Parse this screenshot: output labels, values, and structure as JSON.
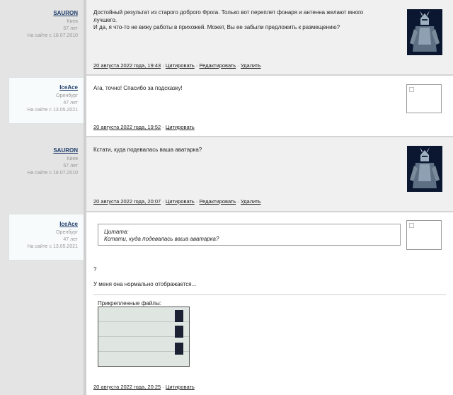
{
  "posts": [
    {
      "author": "SAURON",
      "city": "Киев",
      "age": "57 лет",
      "since": "На сайте с 18.07.2010",
      "lines": [
        "Достойный результат из старого доброго Фрога. Только вот переплет фонаря и антенна желают много",
        "лучшего.",
        "И да, я что-то не вижу работы в прихожей. Может, Вы ее забыли предложить к размещению?"
      ],
      "date": "20 августа 2022 года, 19:43",
      "quote_link": "Цитировать",
      "edit_link": "Редактировать",
      "delete_link": "Удалить"
    },
    {
      "author": "IceAce",
      "city": "Оренбург",
      "age": "47 лет",
      "since": "На сайте с 13.05.2021",
      "lines": [
        "Ага, точно! Спасибо за подсказку!"
      ],
      "date": "20 августа 2022 года, 19:52",
      "quote_link": "Цитировать"
    },
    {
      "author": "SAURON",
      "city": "Киев",
      "age": "57 лет",
      "since": "На сайте с 18.07.2010",
      "lines": [
        "Кстати, куда подевалась ваша аватарка?"
      ],
      "date": "20 августа 2022 года, 20:07",
      "quote_link": "Цитировать",
      "edit_link": "Редактировать",
      "delete_link": "Удалить"
    },
    {
      "author": "IceAce",
      "city": "Оренбург",
      "age": "47 лет",
      "since": "На сайте с 13.05.2021",
      "quote_title": "Цитата:",
      "quote_text": "Кстати, куда подевалась ваша аватарка?",
      "reply_mark": "?",
      "reply_text": "У меня она нормально отображается...",
      "attachments_label": "Прикрепленные файлы:",
      "date": "20 августа 2022 года, 20:25",
      "quote_link": "Цитировать"
    }
  ],
  "separator": " · "
}
